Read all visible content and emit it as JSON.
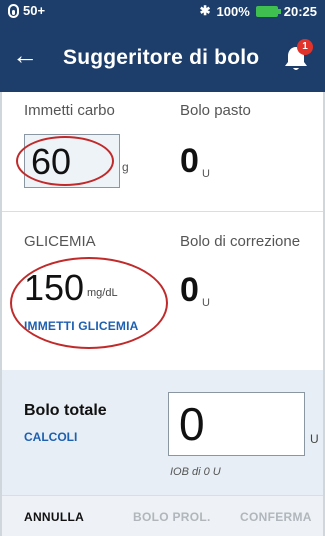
{
  "status_bar": {
    "pod_level": "50+",
    "battery": "100%",
    "time": "20:25"
  },
  "header": {
    "title": "Suggeritore di bolo",
    "notification_count": "1"
  },
  "carbs": {
    "label": "Immetti carbo",
    "value": "60",
    "unit": "g"
  },
  "meal_bolus": {
    "label": "Bolo pasto",
    "value": "0",
    "unit": "U"
  },
  "glucose": {
    "label": "GLICEMIA",
    "value": "150",
    "unit": "mg/dL",
    "link": "IMMETTI GLICEMIA"
  },
  "correction_bolus": {
    "label": "Bolo di correzione",
    "value": "0",
    "unit": "U"
  },
  "total": {
    "label": "Bolo totale",
    "calc_link": "CALCOLI",
    "value": "0",
    "unit": "U",
    "iob": "IOB di 0 U"
  },
  "footer": {
    "cancel": "ANNULLA",
    "extended": "BOLO PROL.",
    "confirm": "CONFERMA"
  },
  "colors": {
    "header_bg": "#1d3e6b",
    "accent_link": "#1d5fb0",
    "annotation_red": "#c02a2a",
    "total_bg": "#e7eef5",
    "badge": "#e2332b"
  },
  "icons": [
    "pod-icon",
    "bluetooth-icon",
    "battery-icon",
    "back-arrow-icon",
    "bell-icon"
  ]
}
